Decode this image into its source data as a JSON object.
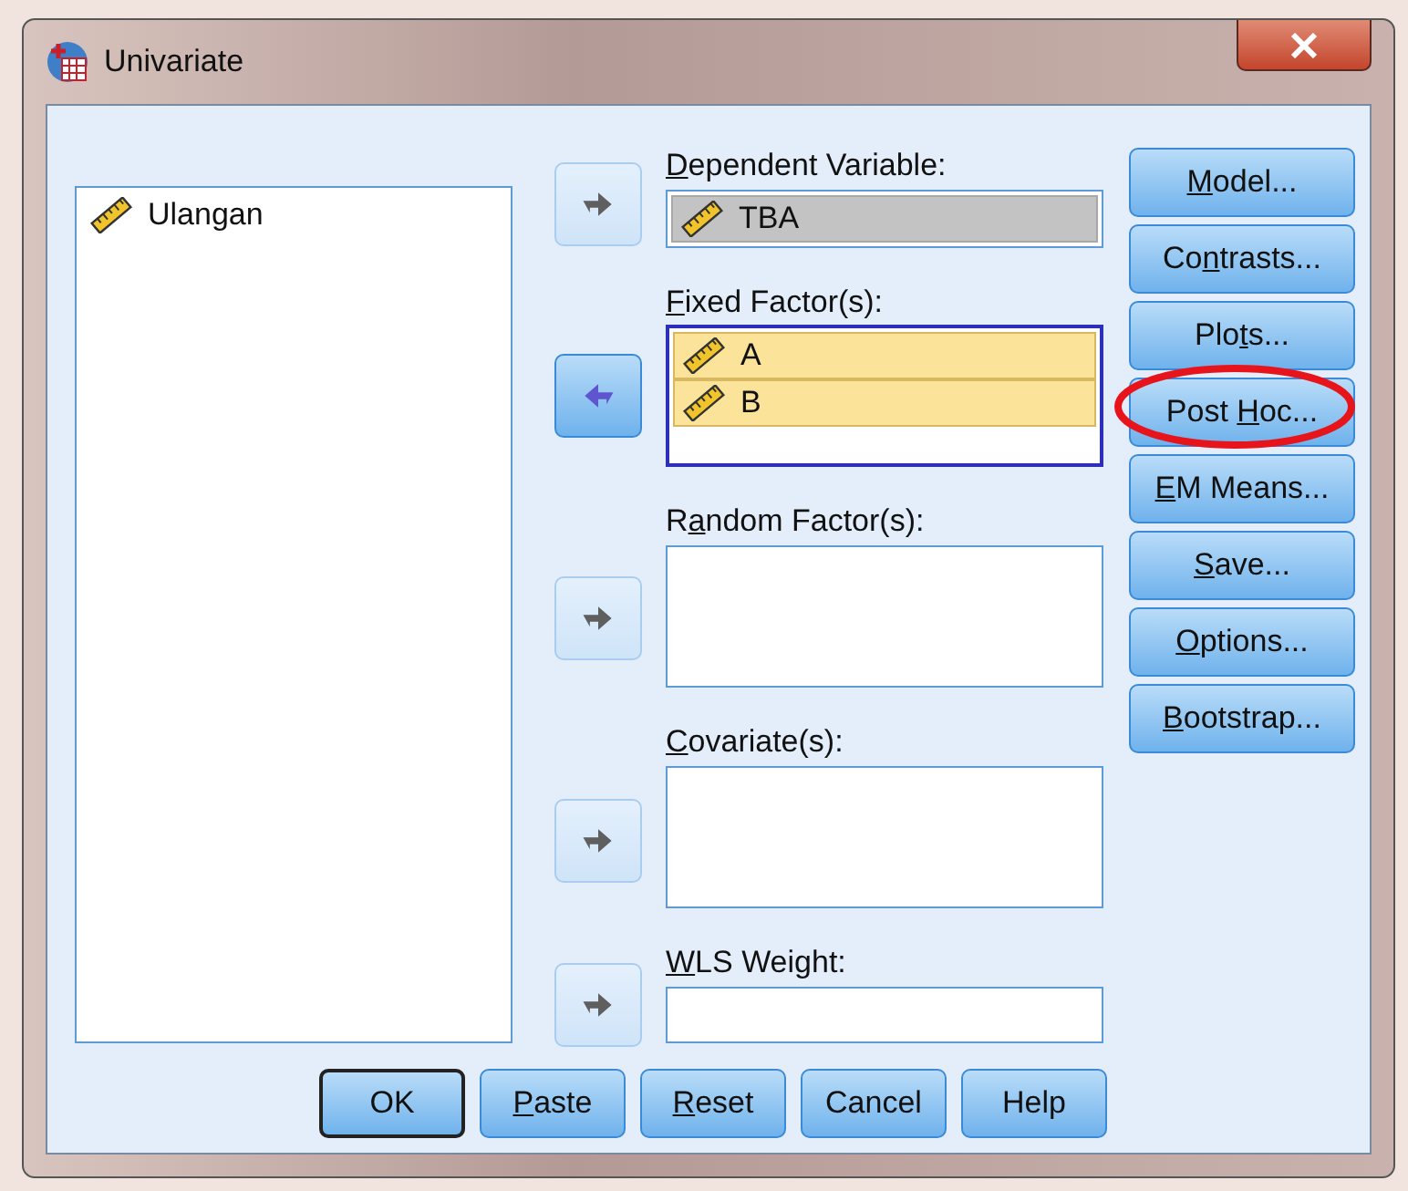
{
  "window": {
    "title": "Univariate"
  },
  "source_list": {
    "items": [
      {
        "label": "Ulangan",
        "selected": false
      }
    ]
  },
  "arrow_buttons": [
    {
      "kind": "right",
      "enabled": false
    },
    {
      "kind": "left",
      "enabled": true
    },
    {
      "kind": "right",
      "enabled": false
    },
    {
      "kind": "right",
      "enabled": false
    },
    {
      "kind": "right",
      "enabled": false
    }
  ],
  "fields": [
    {
      "label": {
        "key": "D",
        "after": "ependent Variable:"
      },
      "focused": false,
      "items": [
        {
          "label": "TBA",
          "selected": true
        }
      ]
    },
    {
      "label": {
        "key": "F",
        "after": "ixed Factor(s):"
      },
      "focused": true,
      "items": [
        {
          "label": "A",
          "selected": true
        },
        {
          "label": "B",
          "selected": true
        }
      ]
    },
    {
      "label": {
        "before": "R",
        "key": "a",
        "after": "ndom Factor(s):"
      },
      "focused": false
    },
    {
      "label": {
        "key": "C",
        "after": "ovariate(s):"
      },
      "focused": false
    },
    {
      "label": {
        "key": "W",
        "after": "LS Weight:"
      },
      "focused": false
    }
  ],
  "side_buttons": [
    {
      "label": {
        "key": "M",
        "after": "odel..."
      },
      "circled": false
    },
    {
      "label": {
        "before": "Co",
        "key": "n",
        "after": "trasts..."
      },
      "circled": false
    },
    {
      "label": {
        "before": "Plo",
        "key": "t",
        "after": "s..."
      },
      "circled": false
    },
    {
      "label": {
        "before": "Post ",
        "key": "H",
        "after": "oc..."
      },
      "circled": true
    },
    {
      "label": {
        "key": "E",
        "after": "M Means..."
      },
      "circled": false
    },
    {
      "label": {
        "key": "S",
        "after": "ave..."
      },
      "circled": false
    },
    {
      "label": {
        "key": "O",
        "after": "ptions..."
      },
      "circled": false
    },
    {
      "label": {
        "key": "B",
        "after": "ootstrap..."
      },
      "circled": false
    }
  ],
  "bottom_buttons": [
    {
      "label": {
        "before": "OK"
      },
      "default": true
    },
    {
      "label": {
        "key": "P",
        "after": "aste"
      },
      "default": false
    },
    {
      "label": {
        "key": "R",
        "after": "eset"
      },
      "default": false
    },
    {
      "label": {
        "before": "Cancel"
      },
      "default": false
    },
    {
      "label": {
        "before": "Help"
      },
      "default": false
    }
  ]
}
